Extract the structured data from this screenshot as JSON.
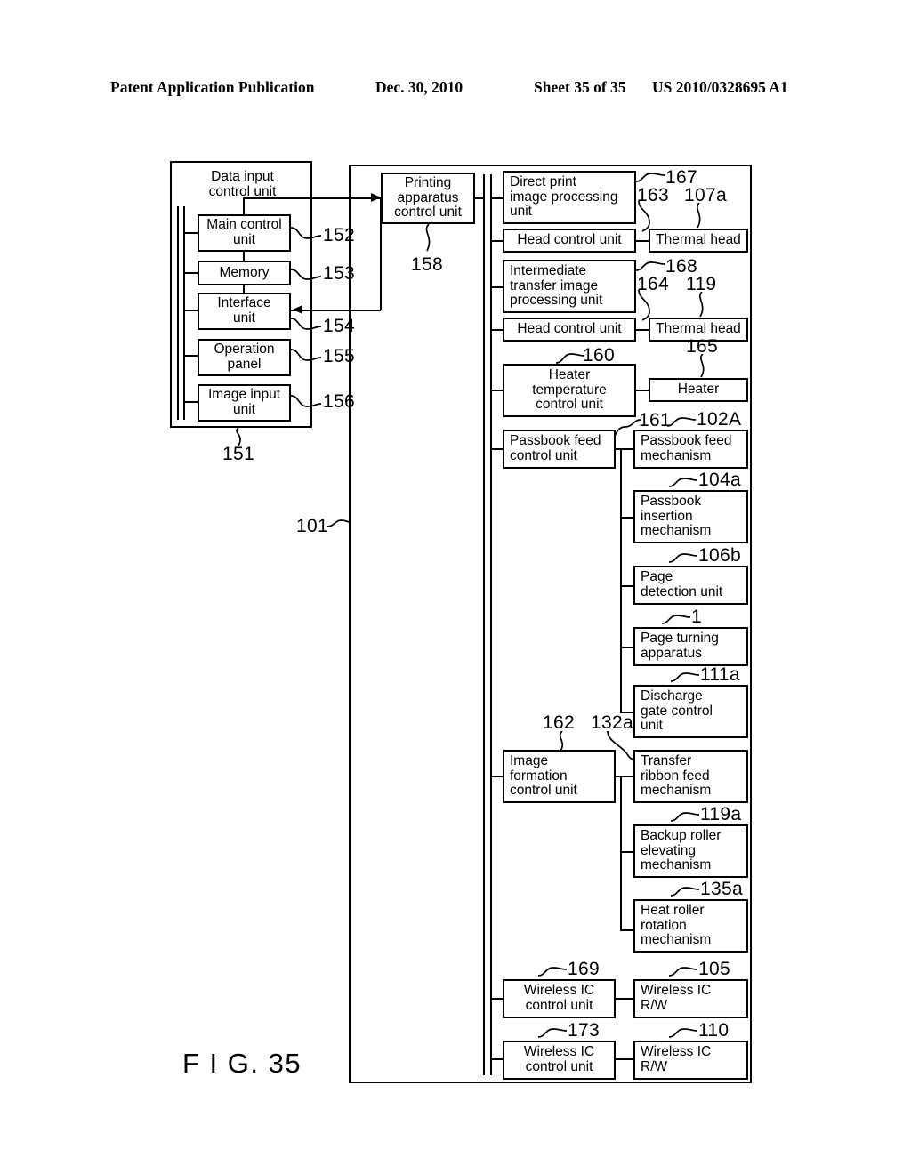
{
  "header": {
    "publication": "Patent Application Publication",
    "date": "Dec. 30, 2010",
    "sheet": "Sheet 35 of 35",
    "number": "US 2010/0328695 A1"
  },
  "figure": {
    "label": "F I G. 35"
  },
  "data_input_unit": {
    "title": "Data input\ncontrol unit",
    "ref": "151",
    "items": [
      {
        "label": "Main control\nunit",
        "ref": "152"
      },
      {
        "label": "Memory",
        "ref": "153"
      },
      {
        "label": "Interface\nunit",
        "ref": "154"
      },
      {
        "label": "Operation\npanel",
        "ref": "155"
      },
      {
        "label": "Image input\nunit",
        "ref": "156"
      }
    ]
  },
  "printing_apparatus": {
    "ref": "101",
    "control_unit": {
      "label": "Printing\napparatus\ncontrol unit",
      "ref": "158"
    },
    "control_blocks": [
      {
        "label": "Direct print\nimage processing\nunit",
        "ref": "167"
      },
      {
        "label": "Head control unit",
        "ref": "163"
      },
      {
        "label": "Intermediate\ntransfer image\nprocessing unit",
        "ref": "168"
      },
      {
        "label": "Head control unit",
        "ref": "164"
      },
      {
        "label": "Heater\ntemperature\ncontrol unit",
        "ref": "160"
      },
      {
        "label": "Passbook feed\ncontrol unit",
        "ref": "161"
      },
      {
        "label": "Image\nformation\ncontrol unit",
        "ref": "162"
      },
      {
        "label": "Wireless IC\ncontrol unit",
        "ref": "169"
      },
      {
        "label": "Wireless IC\ncontrol unit",
        "ref": "173"
      }
    ],
    "device_blocks": [
      {
        "label": "Thermal head",
        "ref": "107a"
      },
      {
        "label": "Thermal head",
        "ref": "119"
      },
      {
        "label": "Heater",
        "ref": "165"
      },
      {
        "label": "Passbook feed\nmechanism",
        "ref": "102A"
      },
      {
        "label": "Passbook\ninsertion\nmechanism",
        "ref": "104a"
      },
      {
        "label": "Page\ndetection unit",
        "ref": "106b"
      },
      {
        "label": "Page turning\napparatus",
        "ref": "1"
      },
      {
        "label": "Discharge\ngate control\nunit",
        "ref": "111a"
      },
      {
        "label": "Transfer\nribbon feed\nmechanism",
        "ref": "132a"
      },
      {
        "label": "Backup roller\nelevating\nmechanism",
        "ref": "119a"
      },
      {
        "label": "Heat roller\nrotation\nmechanism",
        "ref": "135a"
      },
      {
        "label": "Wireless IC\nR/W",
        "ref": "105"
      },
      {
        "label": "Wireless IC\nR/W",
        "ref": "110"
      }
    ]
  }
}
